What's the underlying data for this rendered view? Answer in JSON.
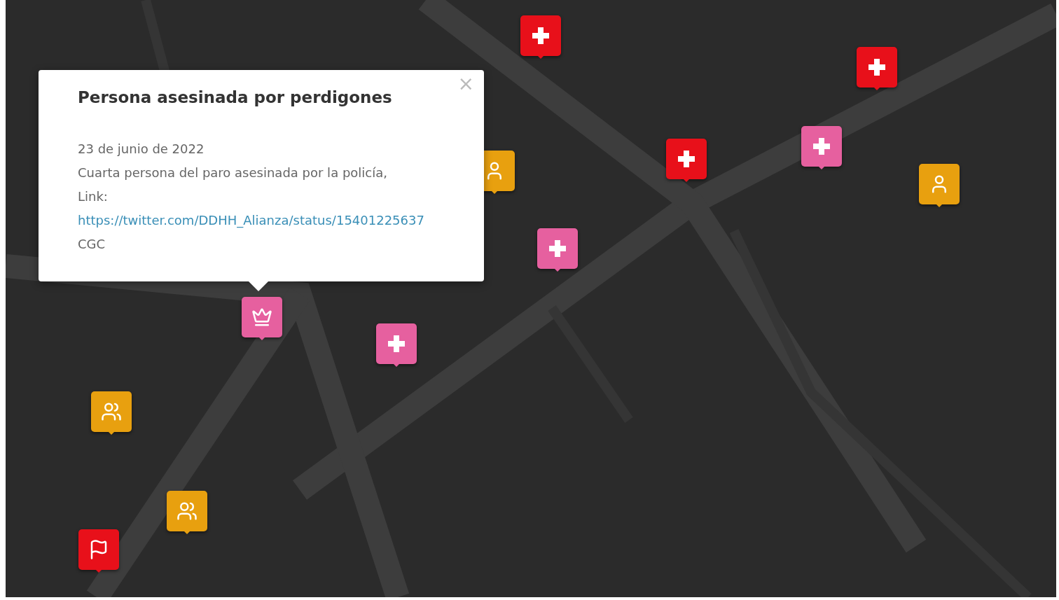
{
  "popup": {
    "title": "Persona asesinada por perdigones",
    "close": "×",
    "date": "23 de junio de 2022",
    "description": "Cuarta persona del paro asesinada por la policía,",
    "link_label": "Link:",
    "link": "https://twitter.com/DDHH_Alianza/status/15401225637",
    "source": "CGC"
  },
  "markers": [
    {
      "kind": "cross",
      "color": "#e8101a"
    },
    {
      "kind": "cross",
      "color": "#e8101a"
    },
    {
      "kind": "cross",
      "color": "#e8101a"
    },
    {
      "kind": "cross",
      "color": "#e6609f"
    },
    {
      "kind": "person",
      "color": "#e8a00f"
    },
    {
      "kind": "person",
      "color": "#e8a00f"
    },
    {
      "kind": "cross",
      "color": "#e6609f"
    },
    {
      "kind": "crown",
      "color": "#e6609f"
    },
    {
      "kind": "cross",
      "color": "#e6609f"
    },
    {
      "kind": "runners",
      "color": "#e8a00f"
    },
    {
      "kind": "runners",
      "color": "#e8a00f"
    },
    {
      "kind": "flag",
      "color": "#e8101a"
    }
  ]
}
